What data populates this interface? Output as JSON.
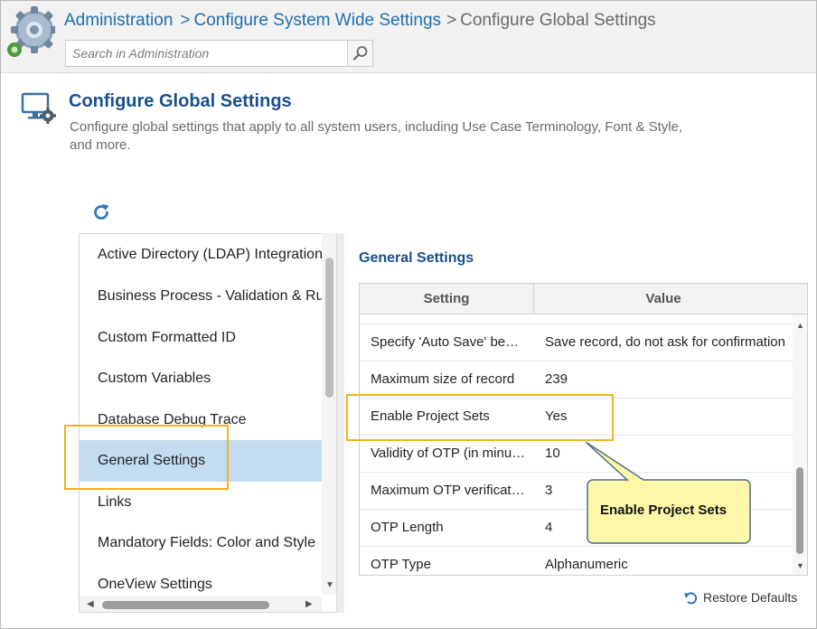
{
  "breadcrumb": {
    "items": [
      "Administration",
      "Configure System Wide Settings",
      "Configure Global Settings"
    ],
    "separator": ">"
  },
  "search": {
    "placeholder": "Search in Administration",
    "value": ""
  },
  "page": {
    "title": "Configure Global Settings",
    "description": "Configure global settings that apply to all system users, including Use Case Terminology, Font & Style, and more."
  },
  "left_list": {
    "items": [
      "Active Directory (LDAP) Integration",
      "Business Process - Validation & Rules",
      "Custom Formatted ID",
      "Custom Variables",
      "Database Debug Trace",
      "General Settings",
      "Links",
      "Mandatory Fields: Color and Style",
      "OneView Settings"
    ],
    "selected": "General Settings"
  },
  "settings": {
    "section_title": "General Settings",
    "columns": [
      "Setting",
      "Value"
    ],
    "rows": [
      {
        "setting": "Specify 'Auto Save' behavior",
        "value": "Save record, do not ask for confirmation"
      },
      {
        "setting": "Maximum size of record",
        "value": "239"
      },
      {
        "setting": "Enable Project Sets",
        "value": "Yes"
      },
      {
        "setting": "Validity of OTP (in minutes)",
        "value": "10"
      },
      {
        "setting": "Maximum OTP verification attempts",
        "value": "3"
      },
      {
        "setting": "OTP Length",
        "value": "4"
      },
      {
        "setting": "OTP Type",
        "value": "Alphanumeric"
      }
    ]
  },
  "callout": {
    "text": "Enable Project Sets"
  },
  "footer": {
    "restore_label": "Restore Defaults"
  },
  "colors": {
    "link_blue": "#1f6fb2",
    "title_blue": "#1a4f8c",
    "selected_row": "#c3dcf1",
    "highlight": "#f0b323",
    "callout_fill": "#fdf7a8"
  },
  "icons": [
    "admin-gear-icon",
    "search-icon",
    "settings-monitor-icon",
    "refresh-icon",
    "restore-icon"
  ]
}
